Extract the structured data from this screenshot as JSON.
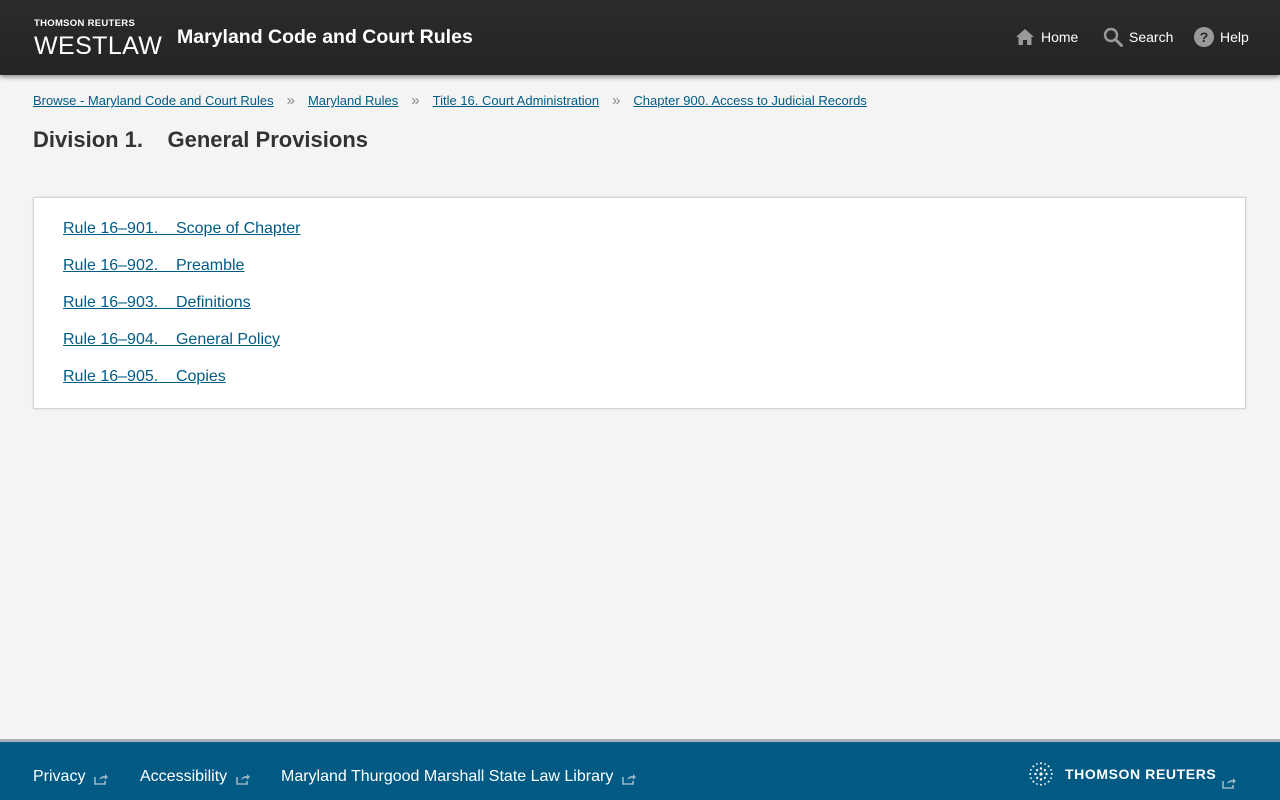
{
  "header": {
    "brand_top": "THOMSON REUTERS",
    "brand_name": "WESTLAW",
    "title": "Maryland Code and Court Rules",
    "nav": {
      "home": "Home",
      "search": "Search",
      "help": "Help"
    }
  },
  "breadcrumb": [
    "Browse - Maryland Code and Court Rules",
    "Maryland Rules",
    "Title 16. Court Administration",
    "Chapter 900. Access to Judicial Records"
  ],
  "page_title": "Division 1.    General Provisions",
  "rules": [
    "Rule 16–901.    Scope of Chapter",
    "Rule 16–902.    Preamble",
    "Rule 16–903.    Definitions",
    "Rule 16–904.    General Policy",
    "Rule 16–905.    Copies"
  ],
  "footer": {
    "links": {
      "privacy": "Privacy",
      "accessibility": "Accessibility",
      "library": "Maryland Thurgood Marshall State Law Library"
    },
    "logo_text": "THOMSON REUTERS"
  },
  "colors": {
    "header_bg": "#262626",
    "link": "#005b85",
    "footer_bg": "#005a84",
    "page_bg": "#f4f4f4"
  },
  "icons": [
    "home-icon",
    "search-icon",
    "help-icon",
    "external-link-icon",
    "thomson-reuters-logo-icon"
  ]
}
